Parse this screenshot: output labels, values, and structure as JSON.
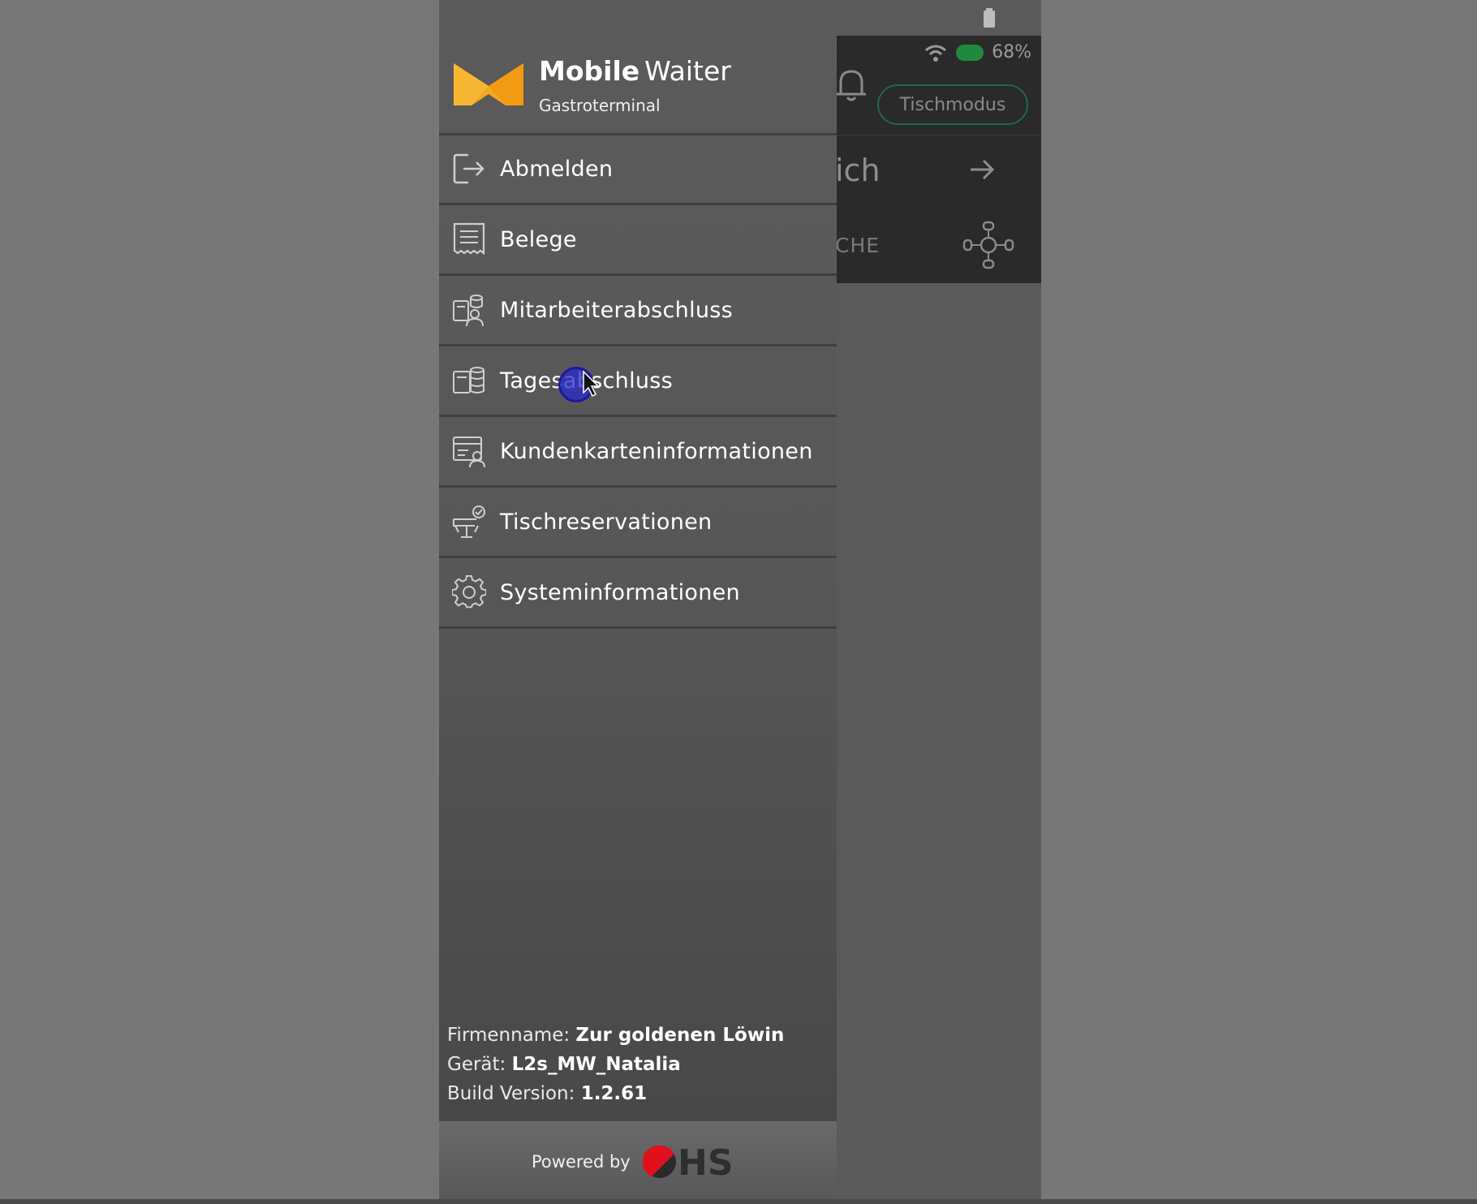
{
  "status": {
    "battery_percent": "68%"
  },
  "background_app": {
    "mode_button": "Tischmodus",
    "row1_text": "ich",
    "row2_text": "CHE"
  },
  "drawer": {
    "brand_bold": "Mobile",
    "brand_light": "Waiter",
    "subtitle": "Gastroterminal",
    "menu": [
      {
        "label": "Abmelden",
        "icon": "logout-icon"
      },
      {
        "label": "Belege",
        "icon": "receipt-icon"
      },
      {
        "label": "Mitarbeiterabschluss",
        "icon": "employee-closing-icon"
      },
      {
        "label": "Tagesabschluss",
        "icon": "day-closing-icon"
      },
      {
        "label": "Kundenkarteninformationen",
        "icon": "customer-card-icon"
      },
      {
        "label": "Tischreservationen",
        "icon": "table-reservation-icon"
      },
      {
        "label": "Systeminformationen",
        "icon": "gear-icon"
      }
    ],
    "info": {
      "company_label": "Firmenname:",
      "company_value": "Zur goldenen Löwin",
      "device_label": "Gerät:",
      "device_value": "L2s_MW_Natalia",
      "build_label": "Build Version:",
      "build_value": "1.2.61"
    },
    "footer": {
      "powered_by": "Powered by",
      "vendor": "HS"
    }
  },
  "colors": {
    "accent_orange": "#f5a623",
    "toggle_green": "#1f8a3e",
    "hs_red": "#e0101c"
  }
}
